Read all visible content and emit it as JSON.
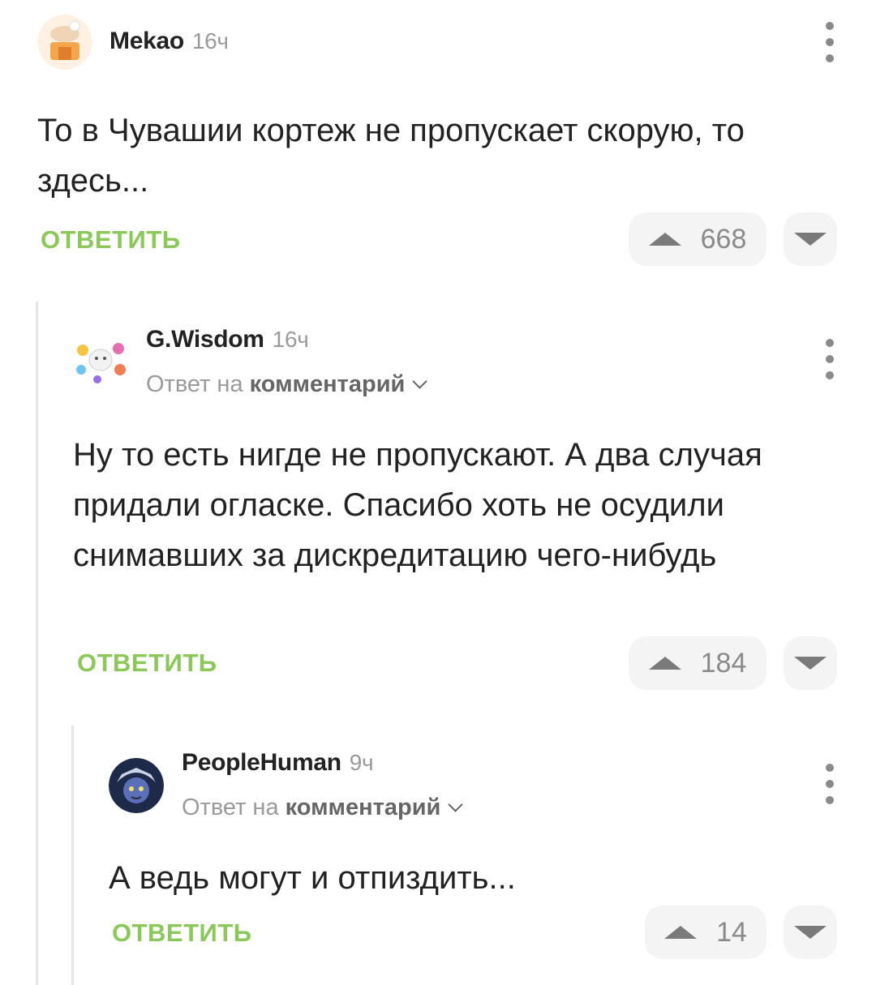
{
  "comments": [
    {
      "author": "Mekao",
      "time": "16ч",
      "text": "То в Чувашии кортеж не пропускает скорую, то здесь...",
      "reply_label": "ОТВЕТИТЬ",
      "rating": "668"
    },
    {
      "author": "G.Wisdom",
      "time": "16ч",
      "reply_to_prefix": "Ответ на",
      "reply_to_target": "комментарий",
      "text": "Ну то есть нигде не пропускают. А два случая придали огласке. Спасибо хоть не осудили снимавших за дискредитацию чего-нибудь",
      "reply_label": "ОТВЕТИТЬ",
      "rating": "184"
    },
    {
      "author": "PeopleHuman",
      "time": "9ч",
      "reply_to_prefix": "Ответ на",
      "reply_to_target": "комментарий",
      "text": "А ведь могут и отпиздить...",
      "reply_label": "ОТВЕТИТЬ",
      "rating": "14"
    }
  ],
  "icons": {
    "menu": "more-vertical-icon",
    "upvote": "triangle-up-icon",
    "downvote": "triangle-down-icon",
    "reply_chevron": "chevron-down-icon"
  },
  "colors": {
    "reply_accent": "#8ac858",
    "muted_text": "#9a9a9a",
    "vote_bg": "#f4f4f4",
    "thread_line": "#e6e6e6"
  }
}
